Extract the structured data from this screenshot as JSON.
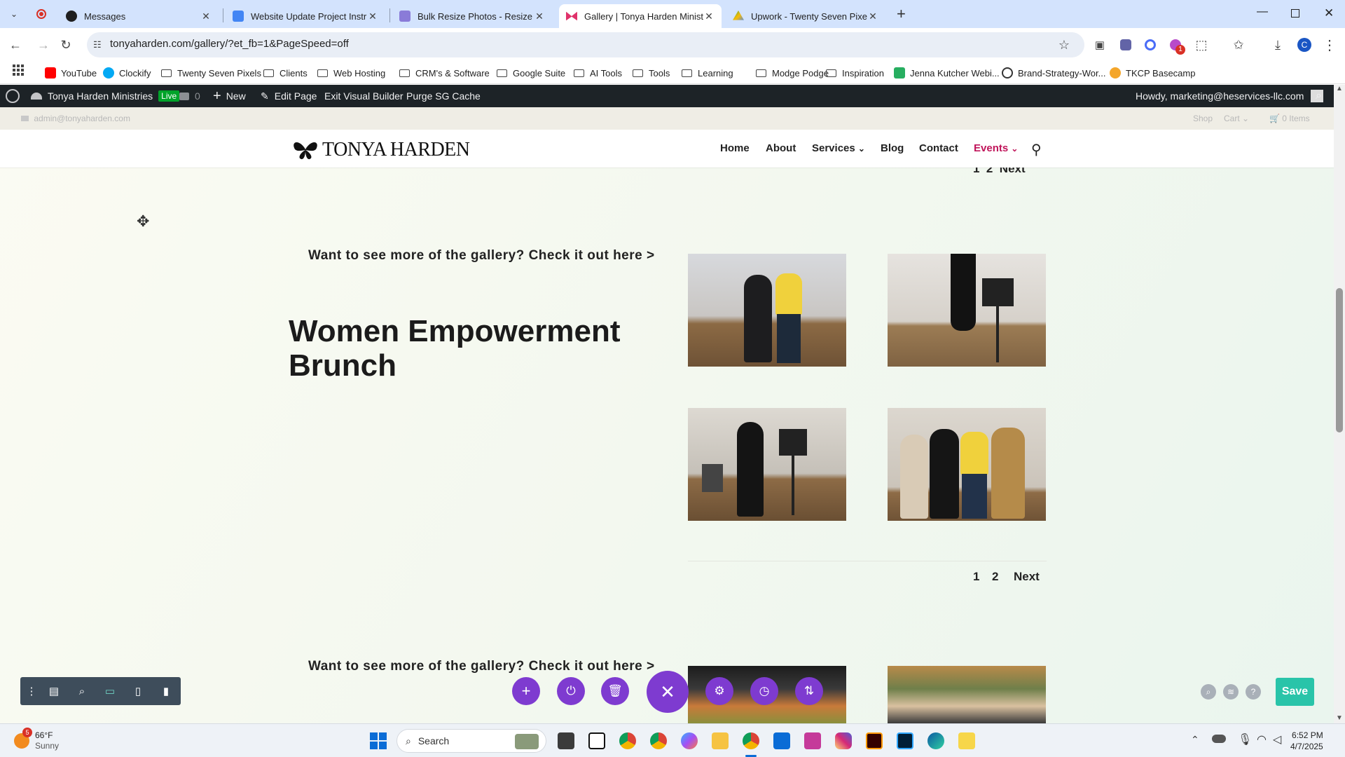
{
  "browser": {
    "tabs": [
      {
        "title": "Messages",
        "color": "#14a800"
      },
      {
        "title": "Website Update Project Instruc",
        "color": "#4285f4"
      },
      {
        "title": "Bulk Resize Photos - Resize Im",
        "color": "#7b68ee"
      },
      {
        "title": "Gallery | Tonya Harden Ministri",
        "color": "#e0336b"
      },
      {
        "title": "Upwork - Twenty Seven Pixels |",
        "color": "#34a853"
      }
    ],
    "new_tab": "+",
    "url": "tonyaharden.com/gallery/?et_fb=1&PageSpeed=off",
    "profile_initial": "C",
    "extension_badge": "1"
  },
  "bookmarks": [
    {
      "label": "YouTube",
      "kind": "site",
      "color": "#ff0000"
    },
    {
      "label": "Clockify",
      "kind": "site",
      "color": "#03a9f4"
    },
    {
      "label": "Twenty Seven Pixels",
      "kind": "folder"
    },
    {
      "label": "Clients",
      "kind": "folder"
    },
    {
      "label": "Web Hosting",
      "kind": "folder"
    },
    {
      "label": "CRM's & Software",
      "kind": "folder"
    },
    {
      "label": "Google Suite",
      "kind": "folder"
    },
    {
      "label": "AI Tools",
      "kind": "folder"
    },
    {
      "label": "Tools",
      "kind": "folder"
    },
    {
      "label": "Learning",
      "kind": "folder"
    },
    {
      "label": "Modge Podge",
      "kind": "folder"
    },
    {
      "label": "Inspiration",
      "kind": "folder"
    },
    {
      "label": "Jenna Kutcher Webi...",
      "kind": "site",
      "color": "#27ae60"
    },
    {
      "label": "Brand-Strategy-Wor...",
      "kind": "site",
      "color": "#333333"
    },
    {
      "label": "TKCP Basecamp",
      "kind": "site",
      "color": "#f4a62a"
    }
  ],
  "wpbar": {
    "site_name": "Tonya Harden Ministries",
    "live_badge": "Live",
    "comments": "0",
    "new": "New",
    "edit_page": "Edit Page",
    "exit_builder": "Exit Visual Builder",
    "purge": "Purge SG Cache",
    "howdy": "Howdy, marketing@heservices-llc.com"
  },
  "site": {
    "topbar_email": "admin@tonyaharden.com",
    "topbar_shop": "Shop",
    "topbar_cart": "Cart",
    "topbar_items": "0 Items",
    "logo_text": "TONYA HARDEN",
    "nav": [
      {
        "label": "Home",
        "dropdown": false
      },
      {
        "label": "About",
        "dropdown": false
      },
      {
        "label": "Services",
        "dropdown": true
      },
      {
        "label": "Blog",
        "dropdown": false
      },
      {
        "label": "Contact",
        "dropdown": false
      },
      {
        "label": "Events",
        "dropdown": true,
        "accent": "#c0155a"
      }
    ],
    "cta_text": "Want to see more of the gallery? Check it out here >",
    "section_title": "Women Empowerment Brunch",
    "pagination": {
      "p1": "1",
      "p2": "2",
      "next": "Next"
    },
    "partial_pagination": "1  2  Next"
  },
  "divi": {
    "accent": "#7e3bd0",
    "save_label": "Save",
    "save_color": "#29c4a9"
  },
  "taskbar": {
    "weather_temp": "66°F",
    "weather_desc": "Sunny",
    "weather_badge": "5",
    "search_label": "Search",
    "time": "6:52 PM",
    "date": "4/7/2025"
  }
}
